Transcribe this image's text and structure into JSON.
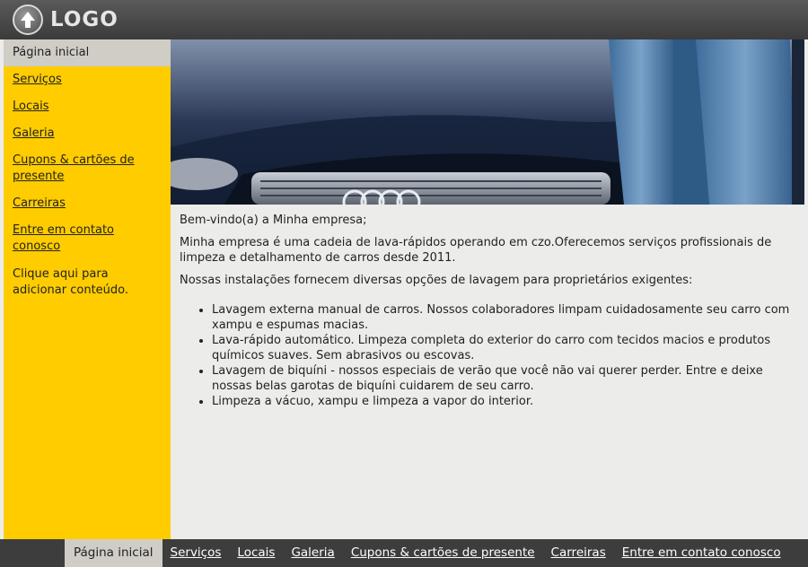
{
  "header": {
    "logo_text": "LOGO"
  },
  "sidebar": {
    "items": [
      {
        "label": "Página inicial"
      },
      {
        "label": "Serviços"
      },
      {
        "label": "Locais"
      },
      {
        "label": "Galeria"
      },
      {
        "label": "Cupons & cartões de presente"
      },
      {
        "label": "Carreiras"
      },
      {
        "label": "Entre em contato conosco"
      }
    ],
    "add_content": "Clique aqui para adicionar conteúdo."
  },
  "main": {
    "welcome": "Bem-vindo(a) a Minha empresa;",
    "intro": "Minha empresa é uma cadeia de lava-rápidos operando em czo.Oferecemos serviços profissionais de limpeza e detalhamento de carros desde 2011.",
    "options_intro": "Nossas instalações fornecem diversas opções de lavagem para proprietários exigentes:",
    "services": [
      "Lavagem externa manual de carros. Nossos colaboradores limpam cuidadosamente seu carro com xampu e espumas macias.",
      "Lava-rápido automático. Limpeza completa do exterior do carro com tecidos macios e produtos químicos suaves. Sem abrasivos ou escovas.",
      "Lavagem de biquíni - nossos especiais de verão que você não vai querer perder. Entre e deixe nossas belas garotas de biquíni cuidarem de seu carro.",
      "Limpeza a vácuo, xampu e limpeza a vapor do interior."
    ]
  },
  "footer": {
    "items": [
      {
        "label": "Página inicial"
      },
      {
        "label": "Serviços"
      },
      {
        "label": "Locais"
      },
      {
        "label": "Galeria"
      },
      {
        "label": "Cupons & cartões de presente"
      },
      {
        "label": "Carreiras"
      },
      {
        "label": "Entre em contato conosco"
      }
    ]
  },
  "icons": {
    "logo": "up-arrow-circle-icon"
  },
  "colors": {
    "sidebar_bg": "#ffcc00",
    "active_bg": "#cfcdc6",
    "topbar_bg": "#454545",
    "footer_bg": "#3d3d3d",
    "page_bg": "#ececea"
  }
}
